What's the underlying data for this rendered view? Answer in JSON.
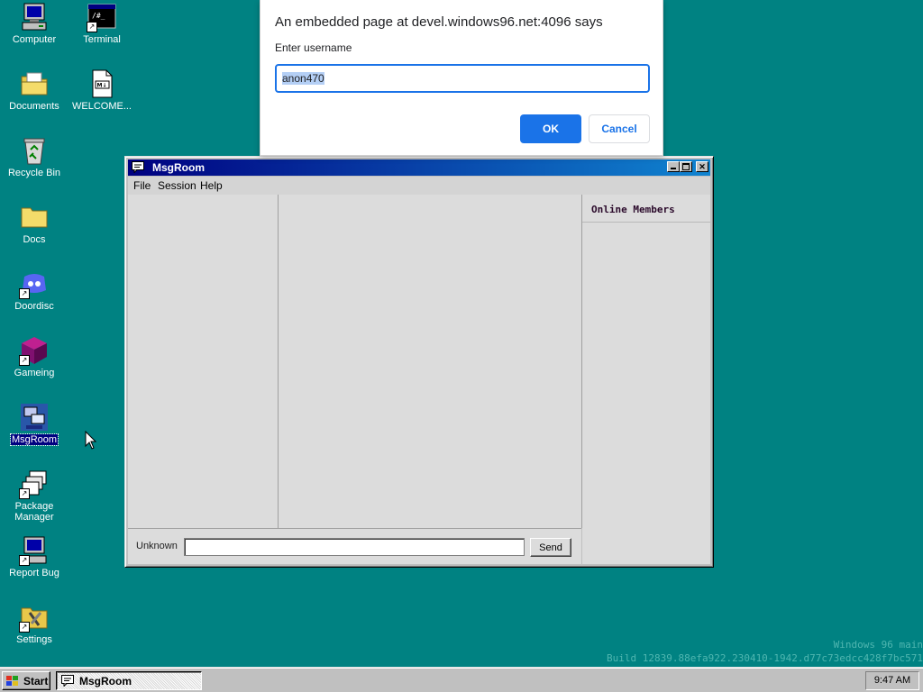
{
  "desktop": {
    "icons": [
      {
        "label": "Computer",
        "icon": "computer-icon"
      },
      {
        "label": "Terminal",
        "icon": "terminal-icon"
      },
      {
        "label": "Documents",
        "icon": "documents-folder-icon"
      },
      {
        "label": "WELCOME...",
        "icon": "markdown-file-icon"
      },
      {
        "label": "Recycle Bin",
        "icon": "recycle-bin-icon"
      },
      {
        "label": "Docs",
        "icon": "folder-icon"
      },
      {
        "label": "Doordisc",
        "icon": "doordisc-icon"
      },
      {
        "label": "Gameing",
        "icon": "cube-icon"
      },
      {
        "label": "MsgRoom",
        "icon": "msgroom-icon",
        "selected": true
      },
      {
        "label": "Package Manager",
        "icon": "package-manager-icon"
      },
      {
        "label": "Report Bug",
        "icon": "report-bug-icon"
      },
      {
        "label": "Settings",
        "icon": "settings-icon"
      }
    ]
  },
  "dialog": {
    "title": "An embedded page at devel.windows96.net:4096 says",
    "message": "Enter username",
    "input_value": "anon470",
    "ok_label": "OK",
    "cancel_label": "Cancel",
    "accent": "#1a73e8"
  },
  "window": {
    "title": "MsgRoom",
    "menu": [
      "File",
      "Session",
      "Help"
    ],
    "online_members_title": "Online Members",
    "username_label": "Unknown",
    "message_input_value": "",
    "send_label": "Send",
    "titlebar_colors": [
      "#000080",
      "#1084d0"
    ]
  },
  "watermark": {
    "line1": "Windows 96 main",
    "line2": "Build 12839.88efa922.230410-1942.d77c73edcc428f7bc571"
  },
  "taskbar": {
    "start_label": "Start",
    "task_label": "MsgRoom",
    "clock": "9:47 AM"
  },
  "theme": {
    "desktop_color": "#008282",
    "face_color": "#c0c0c0"
  }
}
